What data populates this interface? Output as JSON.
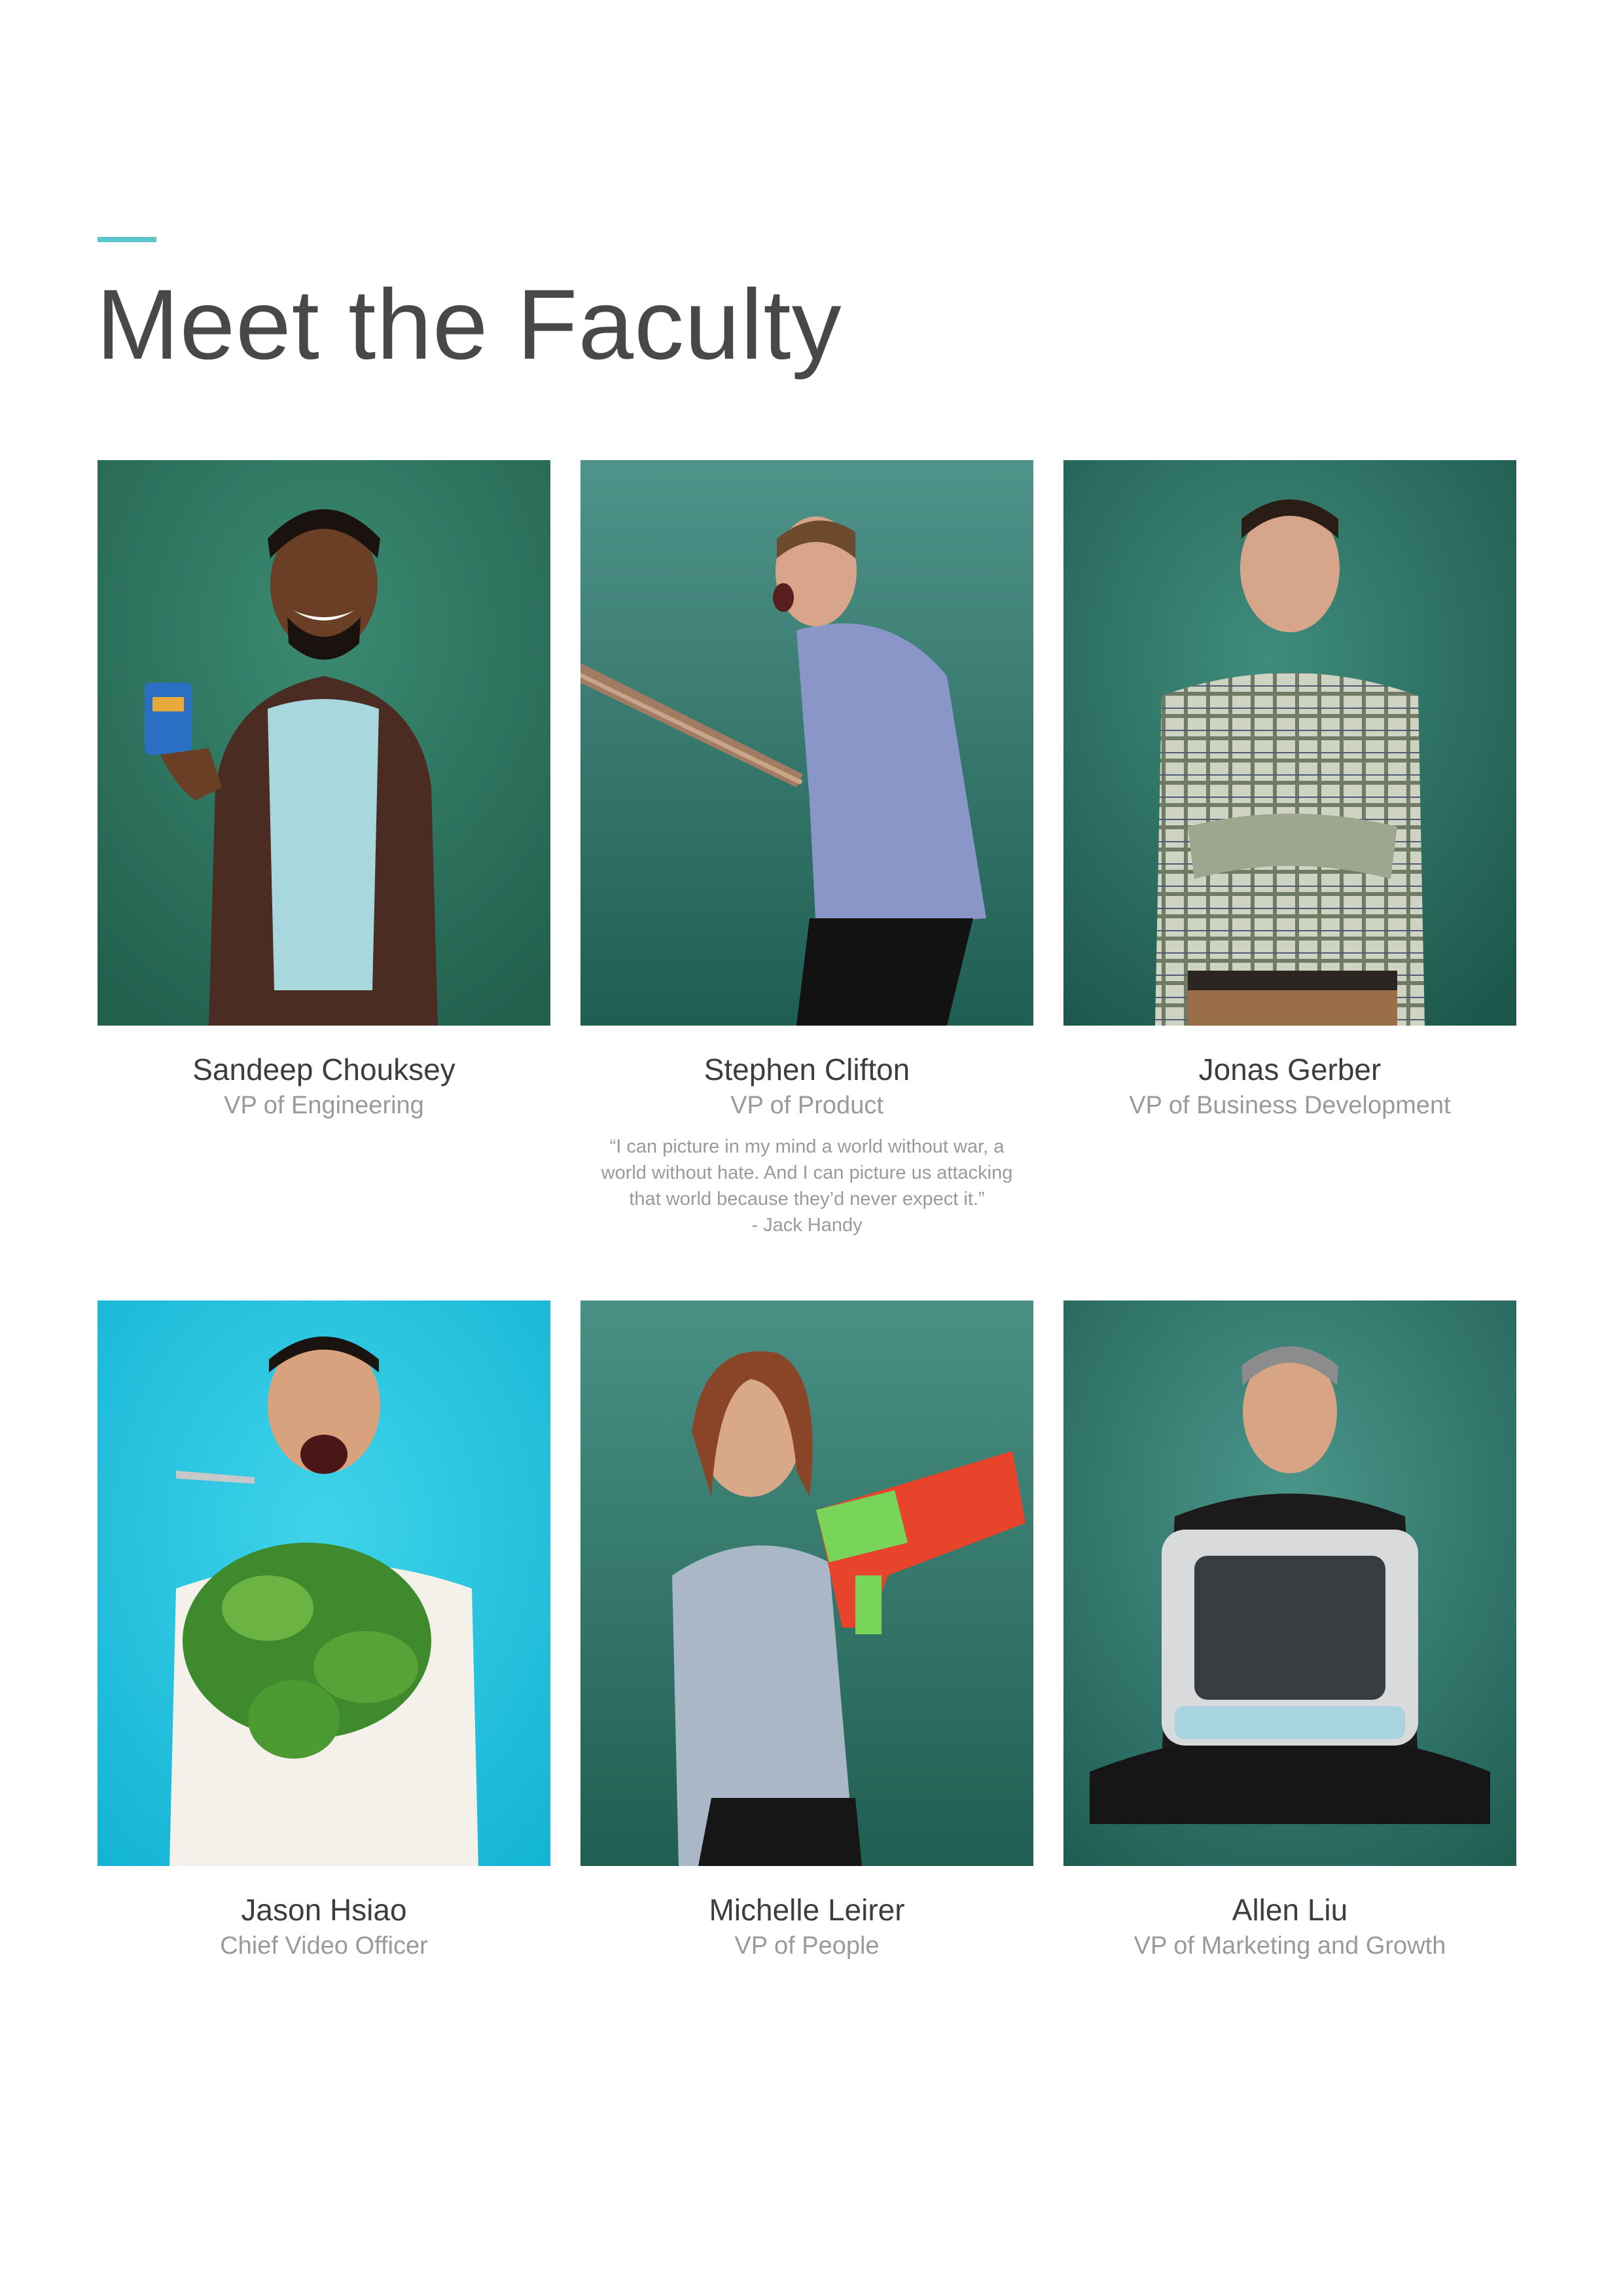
{
  "page": {
    "title": "Meet the Faculty",
    "accent_color": "#5cc6cc"
  },
  "faculty": [
    {
      "name": "Sandeep Chouksey",
      "role": "VP of Engineering",
      "photo_background": "#2d7a62"
    },
    {
      "name": "Stephen Clifton",
      "role": "VP of Product",
      "photo_background": "#357e74",
      "quote": "“I can picture in my mind a world without war, a world without hate. And I can picture us attacking that world because they’d never expect it.”",
      "quote_author": "- Jack Handy"
    },
    {
      "name": "Jonas Gerber",
      "role": "VP of Business Development",
      "photo_background": "#2d7a6c"
    },
    {
      "name": "Jason Hsiao",
      "role": "Chief Video Officer",
      "photo_background": "#1fc4de"
    },
    {
      "name": "Michelle Leirer",
      "role": "VP of People",
      "photo_background": "#2f7c6e"
    },
    {
      "name": "Allen Liu",
      "role": "VP of Marketing and Growth",
      "photo_background": "#357e72"
    }
  ]
}
